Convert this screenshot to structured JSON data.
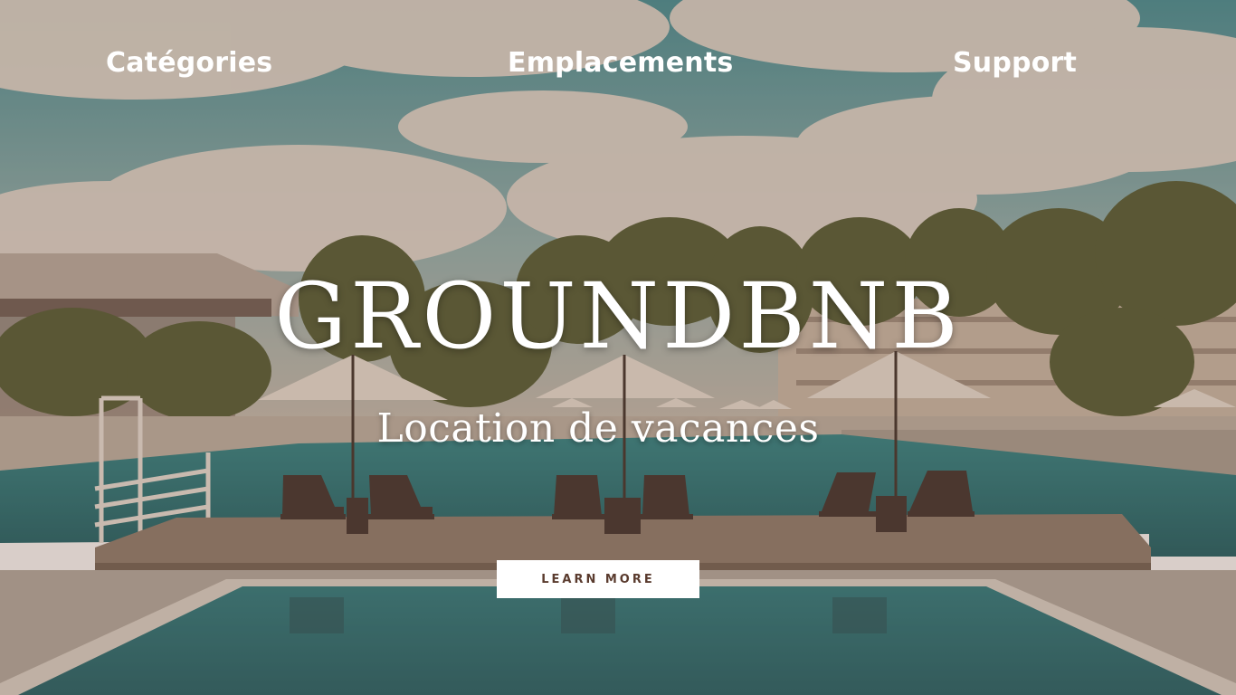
{
  "nav": {
    "categories": "Catégories",
    "locations": "Emplacements",
    "support": "Support"
  },
  "hero": {
    "brand": "GROUNDBNB",
    "tagline": "Location de vacances",
    "cta_label": "LEARN MORE"
  },
  "colors": {
    "cta_text": "#5a3b2e",
    "overlay": "#78503c",
    "pool": "#1f6e72",
    "sky": "#3a8a94"
  }
}
